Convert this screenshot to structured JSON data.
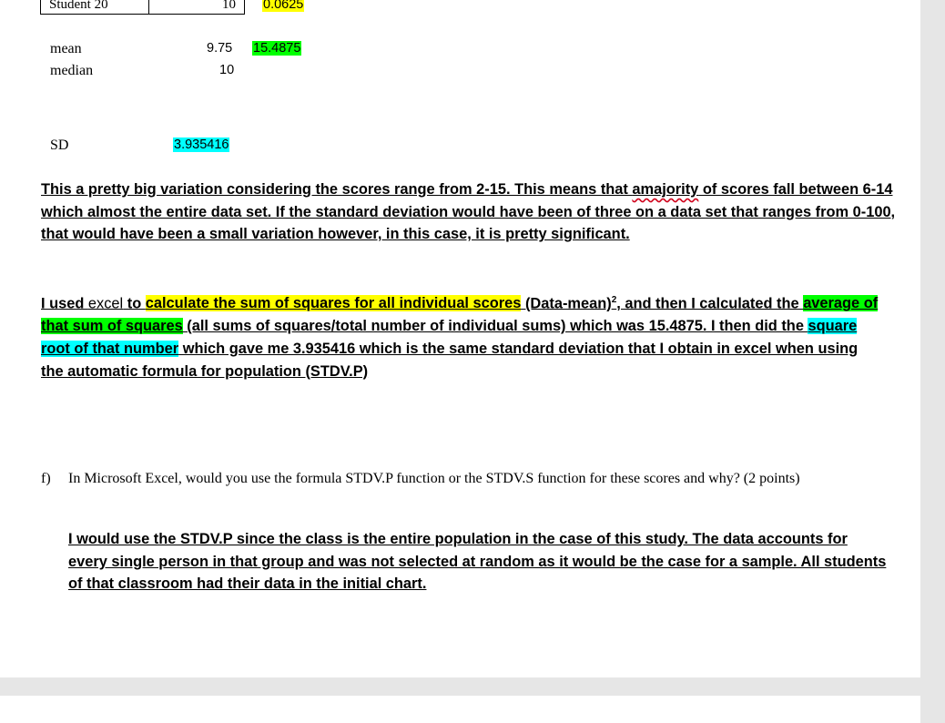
{
  "table": {
    "row_label": "Student 20",
    "row_value": "10",
    "row_extra": "0.0625"
  },
  "stats": {
    "mean_label": "mean",
    "mean_value": "9.75",
    "mean_extra": "15.4875",
    "median_label": "median",
    "median_value": "10",
    "sd_label": "SD",
    "sd_value": "3.935416"
  },
  "paragraph1": {
    "part1": "This a pretty big variation considering the scores range from 2-15. This means that ",
    "misspelled": "amajority",
    "part2": " of scores fall between 6-14 which almost the entire data set. If the standard deviation would have been of three on a data set that ranges from 0-100, that would have been a small variation however, in this case, it is pretty significant."
  },
  "paragraph2": {
    "t1": "I used ",
    "t_excel": "excel",
    "t2": " to ",
    "h_yellow": "calculate the sum of squares for all individual scores",
    "t3": " (Data-mean)",
    "t_sup": "2",
    "t4": ", and then I calculated the ",
    "h_green": "average of that sum of squares",
    "t5": " (all sums of squares/total number of individual sums) which was 15.4875. I then did the ",
    "h_cyan": "square root of that number",
    "t6": " which gave me 3.935416 which is the same standard deviation that I obtain in excel when using the automatic formula for population (STDV.P)"
  },
  "question_f": {
    "label": "f)",
    "text": "In Microsoft Excel, would you use the formula STDV.P function or the STDV.S function for these scores and why? (2 points)"
  },
  "answer_f": "I would use the STDV.P since the class is the entire population in the case of this study. The data accounts for every single person in that group and was not selected at random as it would be the case for a sample. All students of that classroom had their data in the initial chart.",
  "colors": {
    "highlight_yellow": "#ffff00",
    "highlight_green": "#00ff00",
    "highlight_cyan": "#00ffff",
    "background": "#e6e6e6"
  }
}
